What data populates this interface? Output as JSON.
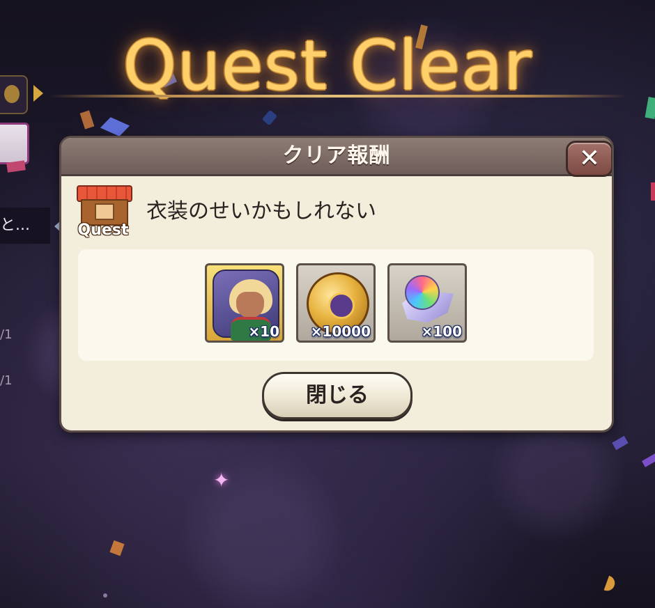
{
  "banner": {
    "title": "Quest Clear"
  },
  "left_ui": {
    "tab_text": "と...",
    "counter_a": "/1",
    "counter_b": "/1"
  },
  "dialog": {
    "title": "クリア報酬",
    "close_symbol": "✕",
    "quest_icon_label": "Quest",
    "quest_name": "衣装のせいかもしれない",
    "rewards": [
      {
        "icon": "character-portrait-icon",
        "quantity": "×10"
      },
      {
        "icon": "gold-coin-medal-icon",
        "quantity": "×10000"
      },
      {
        "icon": "rainbow-orb-crystal-icon",
        "quantity": "×100"
      }
    ],
    "close_button_label": "閉じる"
  },
  "colors": {
    "title_gold": "#ffcf6a",
    "dialog_bg": "#f3eddc",
    "header_bg": "#7c6a64",
    "close_btn": "#8f5d55"
  }
}
